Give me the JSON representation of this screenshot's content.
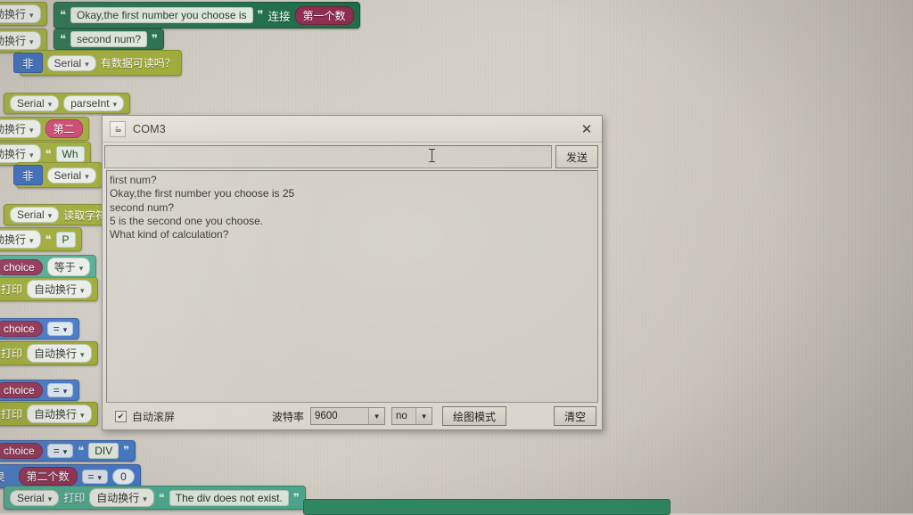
{
  "window": {
    "title": "COM3",
    "icon": "java-icon",
    "close_label": "✕",
    "send_button": "发送",
    "send_input_value": "",
    "console_lines": [
      "first num?",
      "Okay,the first number you choose is 25",
      "second num?",
      "5 is the second one you choose.",
      "What kind of calculation?"
    ],
    "bottom_bar": {
      "autoscroll_label": "自动滚屏",
      "autoscroll_checked": true,
      "check_glyph": "✔",
      "baud_label": "波特率",
      "baud_value": "9600",
      "line_ending_value": "no",
      "arrow_glyph": "▼",
      "plot_mode_button": "绘图模式",
      "clear_button": "清空"
    }
  },
  "workspace": {
    "blocks": [
      {
        "id": "b1",
        "kind": "print-newline",
        "label": "动换行"
      },
      {
        "id": "b2",
        "kind": "join-string",
        "quote_open": "❝",
        "text": "Okay,the first number you choose is",
        "quote_close": "❞",
        "join_label": "连接",
        "variable": "第一个数"
      },
      {
        "id": "b3",
        "kind": "print-newline",
        "label": "动换行"
      },
      {
        "id": "b4",
        "kind": "string",
        "quote_open": "❝",
        "text": "second num?",
        "quote_close": "❞"
      },
      {
        "id": "b5",
        "kind": "not-serial",
        "not_label": "非",
        "serial_label": "Serial",
        "question": "有数据可读吗？"
      },
      {
        "id": "b6",
        "kind": "serial-parse",
        "serial_label": "Serial",
        "method": "parseInt"
      },
      {
        "id": "b7",
        "kind": "print-var",
        "label": "动换行",
        "variable": "第二"
      },
      {
        "id": "b8",
        "kind": "print-string",
        "label": "动换行",
        "quote_open": "❝",
        "text": "Wh"
      },
      {
        "id": "b9",
        "kind": "not-serial",
        "not_label": "非",
        "serial_label": "Serial"
      },
      {
        "id": "b10",
        "kind": "serial-read",
        "serial_label": "Serial",
        "method": "读取字符"
      },
      {
        "id": "b11",
        "kind": "print-string",
        "label": "动换行",
        "quote_open": "❝",
        "text": "P"
      },
      {
        "id": "b12",
        "kind": "compare",
        "variable": "choice",
        "op": "等于"
      },
      {
        "id": "b13",
        "kind": "serial-print",
        "print_label": "打印",
        "newline_label": "自动换行"
      },
      {
        "id": "b14",
        "kind": "compare",
        "variable": "choice",
        "op": "="
      },
      {
        "id": "b15",
        "kind": "serial-print",
        "print_label": "打印",
        "newline_label": "自动换行"
      },
      {
        "id": "b16",
        "kind": "compare",
        "variable": "choice",
        "op": "="
      },
      {
        "id": "b17",
        "kind": "serial-print",
        "print_label": "打印",
        "newline_label": "自动换行"
      },
      {
        "id": "b18",
        "kind": "compare-str",
        "variable": "choice",
        "op": "=",
        "quote_open": "❝",
        "text": "DIV",
        "quote_close": "❞"
      },
      {
        "id": "b19",
        "kind": "if-compare",
        "if_label": "果",
        "variable": "第二个数",
        "op": "=",
        "value": "0"
      },
      {
        "id": "b20",
        "kind": "serial-print-string",
        "serial_label": "Serial",
        "print_label": "打印",
        "newline_label": "自动换行",
        "quote_open": "❝",
        "text": "The div does not exist.",
        "quote_close": "❞"
      }
    ]
  },
  "colors": {
    "serial_green": "#2f8a63",
    "print_olive": "#9aa62f",
    "logic_blue": "#3f74c4",
    "text_teal": "#4aa98e",
    "variable_magenta": "#8e2b4f",
    "window_face": "#d9d5cb",
    "console_face": "#cfcbc2"
  }
}
